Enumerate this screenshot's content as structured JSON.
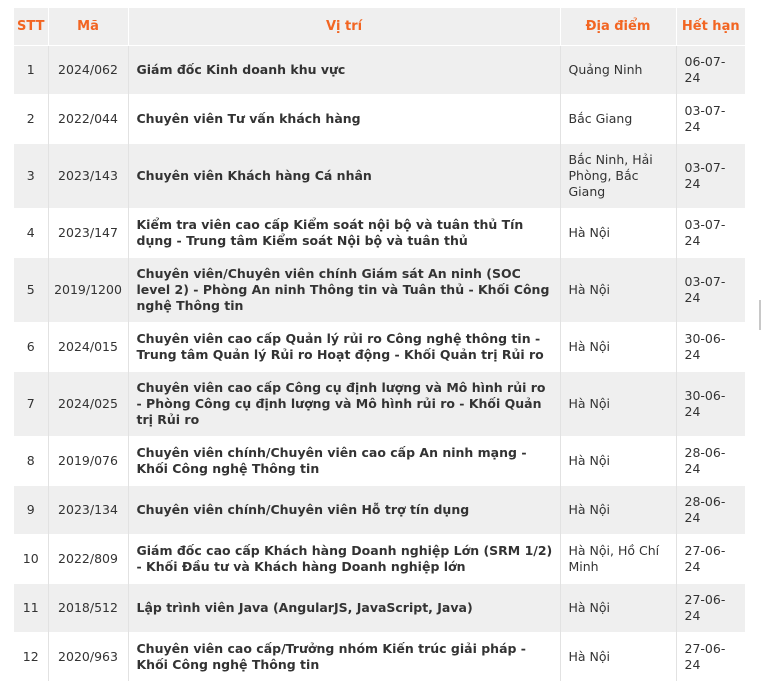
{
  "headers": {
    "stt": "STT",
    "ma": "Mã",
    "vitri": "Vị trí",
    "diadiem": "Địa điểm",
    "hethan": "Hết hạn"
  },
  "rows": [
    {
      "stt": "1",
      "ma": "2024/062",
      "vitri": "Giám đốc Kinh doanh khu vực",
      "diadiem": "Quảng Ninh",
      "hethan": "06-07-24"
    },
    {
      "stt": "2",
      "ma": "2022/044",
      "vitri": "Chuyên viên Tư vấn khách hàng",
      "diadiem": "Bắc Giang",
      "hethan": "03-07-24"
    },
    {
      "stt": "3",
      "ma": "2023/143",
      "vitri": "Chuyên viên Khách hàng Cá nhân",
      "diadiem": "Bắc Ninh, Hải Phòng, Bắc Giang",
      "hethan": "03-07-24"
    },
    {
      "stt": "4",
      "ma": "2023/147",
      "vitri": "Kiểm tra viên cao cấp Kiểm soát nội bộ và tuân thủ Tín dụng - Trung tâm Kiểm soát Nội bộ và tuân thủ",
      "diadiem": "Hà Nội",
      "hethan": "03-07-24"
    },
    {
      "stt": "5",
      "ma": "2019/1200",
      "vitri": "Chuyên viên/Chuyên viên chính Giám sát An ninh (SOC level 2) - Phòng An ninh Thông tin và Tuân thủ - Khối Công nghệ Thông tin",
      "diadiem": "Hà Nội",
      "hethan": "03-07-24"
    },
    {
      "stt": "6",
      "ma": "2024/015",
      "vitri": "Chuyên viên cao cấp Quản lý rủi ro Công nghệ thông tin - Trung tâm Quản lý Rủi ro Hoạt động - Khối Quản trị Rủi ro",
      "diadiem": "Hà Nội",
      "hethan": "30-06-24"
    },
    {
      "stt": "7",
      "ma": "2024/025",
      "vitri": "Chuyên viên cao cấp Công cụ định lượng và Mô hình rủi ro - Phòng Công cụ định lượng và Mô hình rủi ro - Khối Quản trị Rủi ro",
      "diadiem": "Hà Nội",
      "hethan": "30-06-24"
    },
    {
      "stt": "8",
      "ma": "2019/076",
      "vitri": "Chuyên viên chính/Chuyên viên cao cấp An ninh mạng - Khối Công nghệ Thông tin",
      "diadiem": "Hà Nội",
      "hethan": "28-06-24"
    },
    {
      "stt": "9",
      "ma": "2023/134",
      "vitri": "Chuyên viên chính/Chuyên viên Hỗ trợ tín dụng",
      "diadiem": "Hà Nội",
      "hethan": "28-06-24"
    },
    {
      "stt": "10",
      "ma": "2022/809",
      "vitri": "Giám đốc cao cấp Khách hàng Doanh nghiệp Lớn (SRM 1/2) - Khối Đầu tư và Khách hàng Doanh nghiệp lớn",
      "diadiem": "Hà Nội, Hồ Chí Minh",
      "hethan": "27-06-24"
    },
    {
      "stt": "11",
      "ma": "2018/512",
      "vitri": "Lập trình viên Java (AngularJS, JavaScript, Java)",
      "diadiem": "Hà Nội",
      "hethan": "27-06-24"
    },
    {
      "stt": "12",
      "ma": "2020/963",
      "vitri": "Chuyên viên cao cấp/Trưởng nhóm Kiến trúc giải pháp - Khối Công nghệ Thông tin",
      "diadiem": "Hà Nội",
      "hethan": "27-06-24"
    }
  ]
}
